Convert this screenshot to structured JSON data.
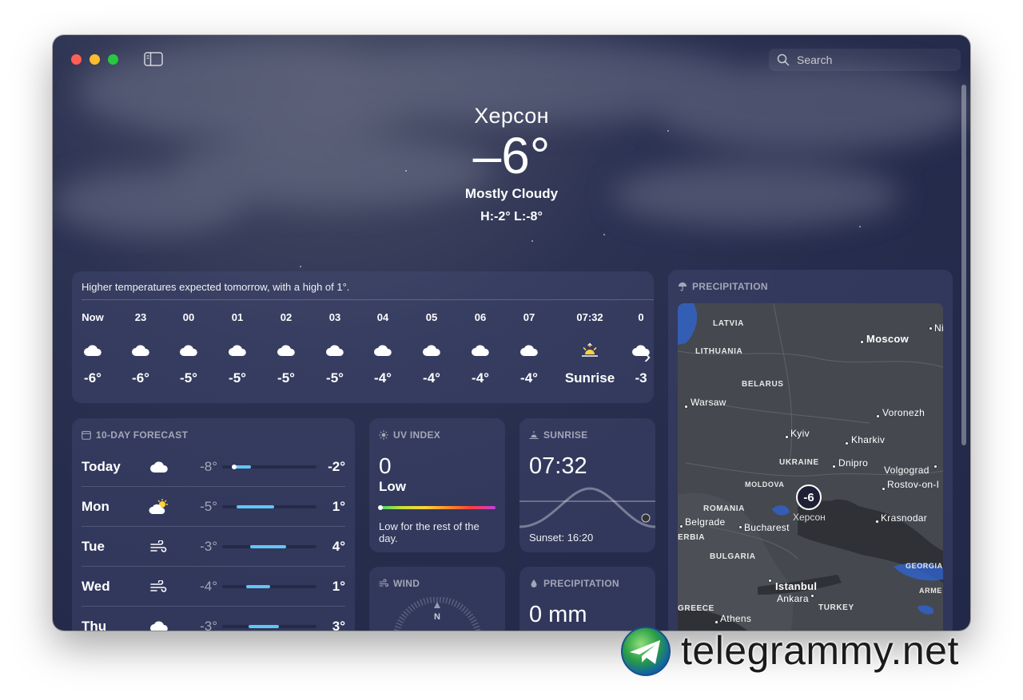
{
  "search": {
    "placeholder": "Search"
  },
  "hero": {
    "city": "Херсон",
    "temperature": "–6°",
    "condition": "Mostly Cloudy",
    "hi_lo": "H:-2°  L:-8°"
  },
  "hourly": {
    "summary": "Higher temperatures expected tomorrow, with a high of 1°.",
    "items": [
      {
        "label": "Now",
        "icon": "cloud-icon",
        "temp": "-6°"
      },
      {
        "label": "23",
        "icon": "cloud-icon",
        "temp": "-6°"
      },
      {
        "label": "00",
        "icon": "cloud-icon",
        "temp": "-5°"
      },
      {
        "label": "01",
        "icon": "cloud-icon",
        "temp": "-5°"
      },
      {
        "label": "02",
        "icon": "cloud-icon",
        "temp": "-5°"
      },
      {
        "label": "03",
        "icon": "cloud-icon",
        "temp": "-5°"
      },
      {
        "label": "04",
        "icon": "cloud-icon",
        "temp": "-4°"
      },
      {
        "label": "05",
        "icon": "cloud-icon",
        "temp": "-4°"
      },
      {
        "label": "06",
        "icon": "cloud-icon",
        "temp": "-4°"
      },
      {
        "label": "07",
        "icon": "cloud-icon",
        "temp": "-4°"
      },
      {
        "label": "07:32",
        "icon": "sunrise-icon",
        "temp": "Sunrise"
      },
      {
        "label": "0",
        "icon": "cloud-icon",
        "temp": "-3"
      }
    ]
  },
  "ten_day": {
    "title": "10-DAY FORECAST",
    "days": [
      {
        "name": "Today",
        "icon": "cloud-icon",
        "low": "-8°",
        "high": "-2°",
        "range_start": 0.1,
        "range_end": 0.3,
        "current": 0.13
      },
      {
        "name": "Mon",
        "icon": "partly-sunny-icon",
        "low": "-5°",
        "high": "1°",
        "range_start": 0.15,
        "range_end": 0.55
      },
      {
        "name": "Tue",
        "icon": "wind-icon",
        "low": "-3°",
        "high": "4°",
        "range_start": 0.3,
        "range_end": 0.68
      },
      {
        "name": "Wed",
        "icon": "wind-icon",
        "low": "-4°",
        "high": "1°",
        "range_start": 0.25,
        "range_end": 0.5
      },
      {
        "name": "Thu",
        "icon": "cloud-icon",
        "low": "-3°",
        "high": "3°",
        "range_start": 0.28,
        "range_end": 0.6
      }
    ]
  },
  "uv": {
    "title": "UV INDEX",
    "value": "0",
    "level": "Low",
    "description": "Low for the rest of the day.",
    "level_fraction": 0
  },
  "sunrise": {
    "title": "SUNRISE",
    "time": "07:32",
    "sunset": "Sunset: 16:20"
  },
  "wind": {
    "title": "WIND",
    "compass_north": "N"
  },
  "precipitation_small": {
    "title": "PRECIPITATION",
    "amount": "0 mm"
  },
  "precipitation_map": {
    "title": "PRECIPITATION",
    "pin_value": "-6",
    "pin_city": "Херсон",
    "countries": [
      "LATVIA",
      "LITHUANIA",
      "BELARUS",
      "UKRAINE",
      "MOLDOVA",
      "ROMANIA",
      "ERBIA",
      "BULGARIA",
      "GREECE",
      "TURKEY",
      "GEORGIA",
      "ARME"
    ],
    "cities": [
      "Moscow",
      "Ni",
      "Warsaw",
      "Voronezh",
      "Kyiv",
      "Kharkiv",
      "Dnipro",
      "Volgograd",
      "Rostov-on-I",
      "Belgrade",
      "Bucharest",
      "Krasnodar",
      "Istanbul",
      "Ankara",
      "Athens"
    ]
  },
  "watermark": {
    "text": "telegrammy.net"
  },
  "colors": {
    "background": "#262c4c",
    "accent_bar": "#62c6f5",
    "close": "#ff5f57",
    "minimize": "#febc2e",
    "zoom": "#28c840"
  }
}
